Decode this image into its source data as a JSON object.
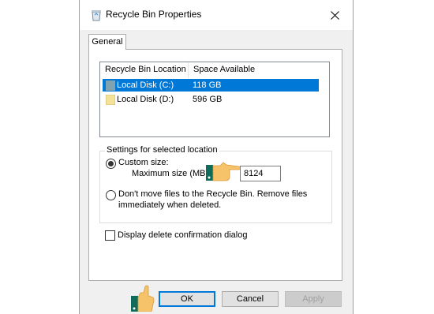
{
  "window": {
    "title": "Recycle Bin Properties"
  },
  "tabs": [
    {
      "label": "General"
    }
  ],
  "locations": {
    "columns": [
      "Recycle Bin Location",
      "Space Available"
    ],
    "rows": [
      {
        "name": "Local Disk (C:)",
        "space": "118 GB",
        "selected": true
      },
      {
        "name": "Local Disk (D:)",
        "space": "596 GB",
        "selected": false
      }
    ]
  },
  "settings": {
    "group_label": "Settings for selected location",
    "custom_size_label": "Custom size:",
    "max_size_label": "Maximum size (MB):",
    "max_size_value": "8124",
    "dont_move_line1": "Don't move files to the Recycle Bin. Remove files",
    "dont_move_line2": "immediately when deleted."
  },
  "confirm_checkbox_label": "Display delete confirmation dialog",
  "buttons": {
    "ok": "OK",
    "cancel": "Cancel",
    "apply": "Apply"
  },
  "colors": {
    "accent": "#0078d7",
    "pointer_skin": "#f6c36b",
    "pointer_cuff": "#0f6b5a"
  }
}
